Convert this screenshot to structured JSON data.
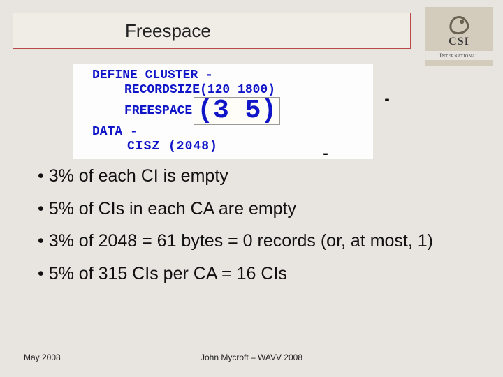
{
  "title": "Freespace",
  "logo": {
    "abbrev": "CSI",
    "sub": "International"
  },
  "code": {
    "line1": "DEFINE CLUSTER -",
    "line2": "RECORDSIZE(120 1800)",
    "line3a": "FREESPACE",
    "line3b": "(3 5)",
    "line4": "DATA -",
    "line5": "CISZ (2048)",
    "dash": "-"
  },
  "bullets": [
    "3% of each CI is empty",
    "5% of CIs in each CA are empty",
    "3% of 2048 = 61 bytes = 0 records (or, at most, 1)",
    "5% of 315 CIs per CA = 16 CIs"
  ],
  "footer": {
    "left": "May 2008",
    "center": "John Mycroft – WAVV 2008"
  }
}
